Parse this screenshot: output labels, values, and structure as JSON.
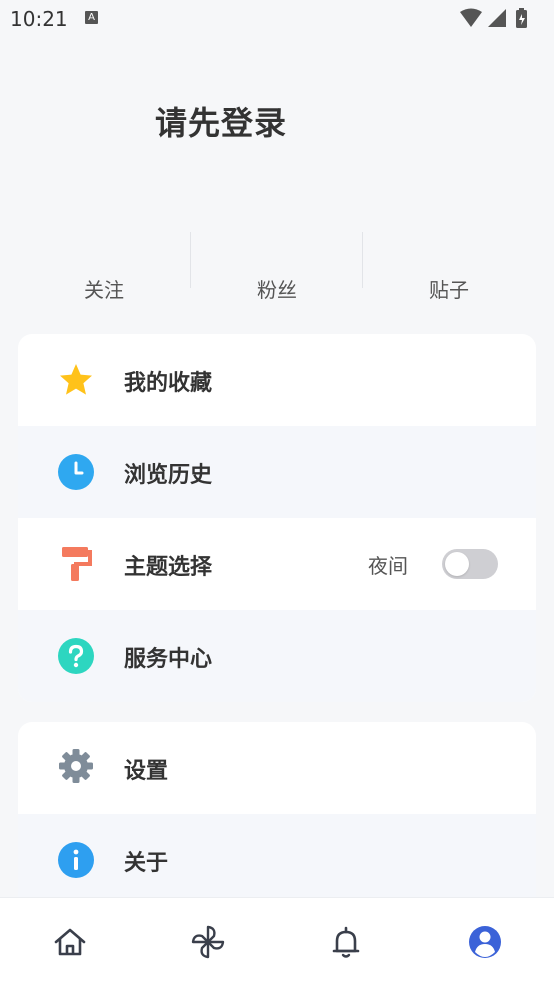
{
  "status_bar": {
    "time": "10:21",
    "notification_glyph": "A"
  },
  "header": {
    "login_prompt": "请先登录"
  },
  "stats": [
    {
      "label": "关注"
    },
    {
      "label": "粉丝"
    },
    {
      "label": "贴子"
    }
  ],
  "menu_group_1": {
    "favorites": {
      "label": "我的收藏",
      "icon": "star-icon",
      "color": "#ffc21a"
    },
    "history": {
      "label": "浏览历史",
      "icon": "clock-icon",
      "color": "#2fa8f0"
    },
    "theme": {
      "label": "主题选择",
      "icon": "paint-roller-icon",
      "color": "#f47a5e",
      "night_label": "夜间",
      "night_enabled": false
    },
    "service": {
      "label": "服务中心",
      "icon": "help-icon",
      "color": "#2dd6c0"
    }
  },
  "menu_group_2": {
    "settings": {
      "label": "设置",
      "icon": "gear-icon",
      "color": "#7f8c99"
    },
    "about": {
      "label": "关于",
      "icon": "info-icon",
      "color": "#2e9ff0"
    }
  },
  "bottom_nav": {
    "items": [
      {
        "icon": "home-icon",
        "active": false
      },
      {
        "icon": "pinwheel-icon",
        "active": false
      },
      {
        "icon": "bell-icon",
        "active": false
      },
      {
        "icon": "profile-icon",
        "active": true
      }
    ],
    "active_color": "#3b62d8",
    "inactive_color": "#3a3f4b"
  }
}
